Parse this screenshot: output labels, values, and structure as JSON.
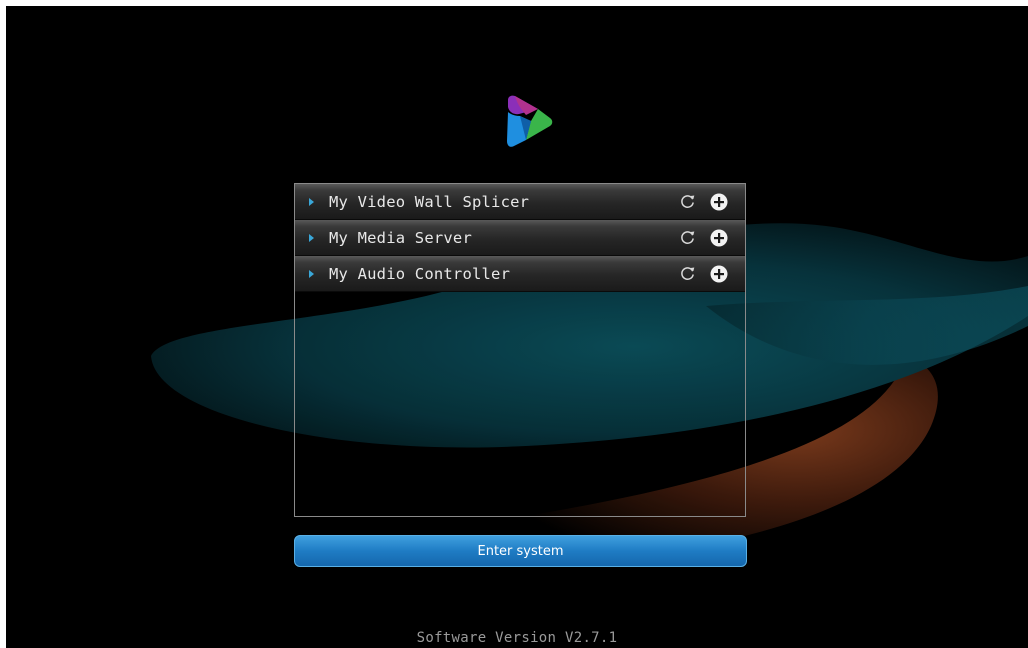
{
  "app": {
    "logo_icon": "play-triangle-logo-icon"
  },
  "devices": [
    {
      "label": "My Video Wall Splicer",
      "refresh_icon": "refresh-icon",
      "add_icon": "plus-circle-icon"
    },
    {
      "label": "My Media Server",
      "refresh_icon": "refresh-icon",
      "add_icon": "plus-circle-icon"
    },
    {
      "label": "My Audio Controller",
      "refresh_icon": "refresh-icon",
      "add_icon": "plus-circle-icon"
    }
  ],
  "enter_button": {
    "label": "Enter system"
  },
  "footer": {
    "version": "Software Version V2.7.1"
  },
  "colors": {
    "accent": "#1f7cc4",
    "background": "#000000",
    "arrow": "#3aa7d8"
  }
}
